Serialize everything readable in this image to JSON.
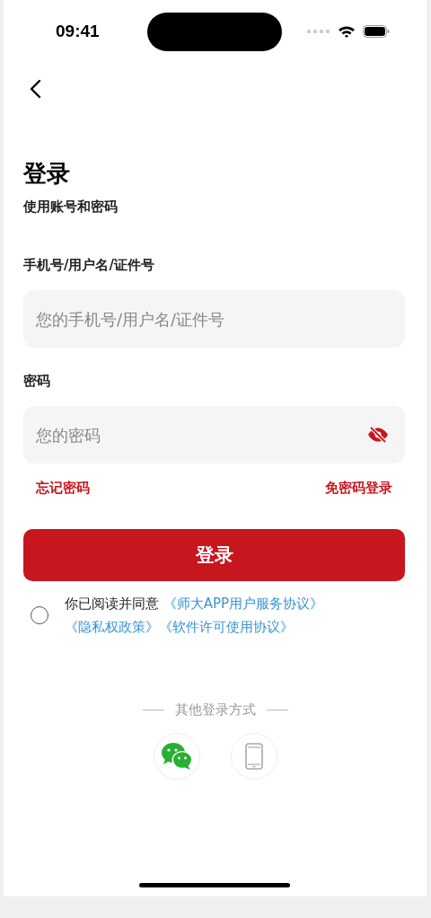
{
  "status_bar": {
    "time": "09:41"
  },
  "title": "登录",
  "subtitle": "使用账号和密码",
  "fields": [
    {
      "label": "手机号/用户名/证件号",
      "placeholder": "您的手机号/用户名/证件号",
      "kind": "text"
    },
    {
      "label": "密码",
      "placeholder": "您的密码",
      "kind": "password",
      "password_visible": false
    }
  ],
  "links": [
    "忘记密码",
    "免密码登录"
  ],
  "login_button": "登录",
  "agreement": {
    "checked": false,
    "text": "你已阅读并同意",
    "links": [
      "《师大APP用户服务协议》",
      "《隐私权政策》",
      "《软件许可使用协议》"
    ]
  },
  "other_login": {
    "label": "其他登录方式",
    "options": [
      {
        "kind": "wechat"
      },
      {
        "kind": "phone"
      }
    ]
  }
}
